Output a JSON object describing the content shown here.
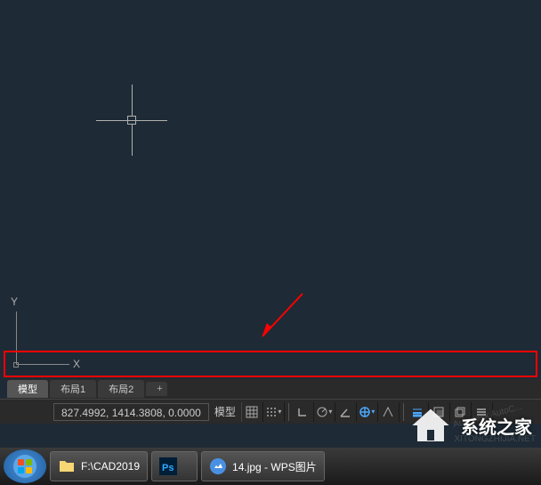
{
  "canvas": {
    "ucs": {
      "x_label": "X",
      "y_label": "Y"
    }
  },
  "tabs": {
    "items": [
      {
        "label": "模型",
        "active": true
      },
      {
        "label": "布局1",
        "active": false
      },
      {
        "label": "布局2",
        "active": false
      }
    ],
    "add_label": "+"
  },
  "status": {
    "coordinates": "827.4992, 1414.3808, 0.0000",
    "model_btn": "模型",
    "dropdown_glyph": "▾"
  },
  "taskbar": {
    "items": [
      {
        "label": "F:\\CAD2019",
        "icon": "folder"
      },
      {
        "label": "",
        "icon": "photoshop"
      },
      {
        "label": "14.jpg - WPS图片",
        "icon": "wps-image"
      }
    ]
  },
  "watermark": {
    "site": "XITONGZHIJIA.NET",
    "brand": "系统之家",
    "autodesk": "Autodesk AutoC..."
  }
}
